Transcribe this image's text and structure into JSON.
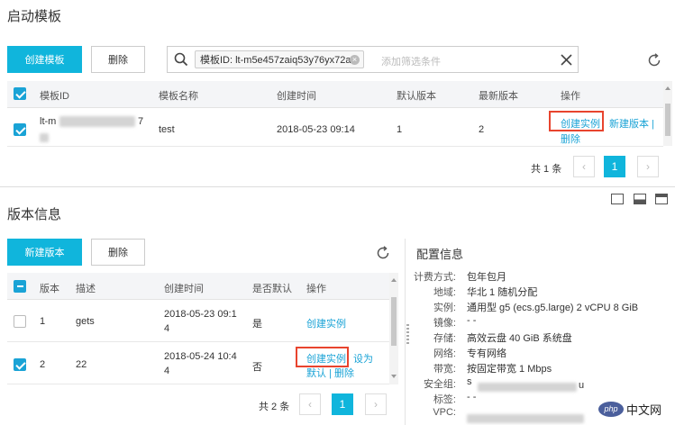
{
  "top": {
    "title": "启动模板",
    "create_btn": "创建模板",
    "delete_btn": "删除",
    "filter_tag": "模板ID: lt-m5e457zaiq53y76yx72a",
    "filter_placeholder": "添加筛选条件",
    "columns": [
      "模板ID",
      "模板名称",
      "创建时间",
      "默认版本",
      "最新版本",
      "操作"
    ],
    "row": {
      "id_prefix": "lt-m",
      "id_suffix": "7",
      "name": "test",
      "created": "2018-05-23 09:14",
      "default_ver": "1",
      "latest_ver": "2",
      "action_create": "创建实例",
      "action_newver": "新建版本 |",
      "action_delete": "删除"
    },
    "total": "共 1 条",
    "page": "1"
  },
  "bottom": {
    "title": "版本信息",
    "new_version_btn": "新建版本",
    "delete_btn": "删除",
    "columns": [
      "版本",
      "描述",
      "创建时间",
      "是否默认",
      "操作"
    ],
    "rows": [
      {
        "ver": "1",
        "desc": "gets",
        "created_1": "2018-05-23 09:1",
        "created_2": "4",
        "is_default": "是",
        "action_create": "创建实例",
        "action_set": "",
        "action_rest": ""
      },
      {
        "ver": "2",
        "desc": "22",
        "created_1": "2018-05-24 10:4",
        "created_2": "4",
        "is_default": "否",
        "action_create": "创建实例",
        "action_set": "设为",
        "action_rest": "默认 | 删除"
      }
    ],
    "total": "共 2 条",
    "page": "1"
  },
  "config": {
    "title": "配置信息",
    "items": [
      {
        "k": "计费方式:",
        "v": "包年包月"
      },
      {
        "k": "地域:",
        "v": "华北 1 随机分配"
      },
      {
        "k": "实例:",
        "v": "通用型 g5 (ecs.g5.large) 2 vCPU 8 GiB"
      },
      {
        "k": "镜像:",
        "v": "- -"
      },
      {
        "k": "存储:",
        "v": "高效云盘 40 GiB 系统盘"
      },
      {
        "k": "网络:",
        "v": "专有网络"
      },
      {
        "k": "带宽:",
        "v": "按固定带宽 1 Mbps"
      },
      {
        "k": "安全组:",
        "v": "s"
      },
      {
        "k": "标签:",
        "v": "- -"
      },
      {
        "k": "VPC:",
        "v": ""
      }
    ],
    "sg_suffix": "u"
  },
  "watermark": "php 中文网",
  "colors": {
    "primary": "#10b5dc",
    "link": "#1aa3d6",
    "highlight": "#e8442e"
  }
}
